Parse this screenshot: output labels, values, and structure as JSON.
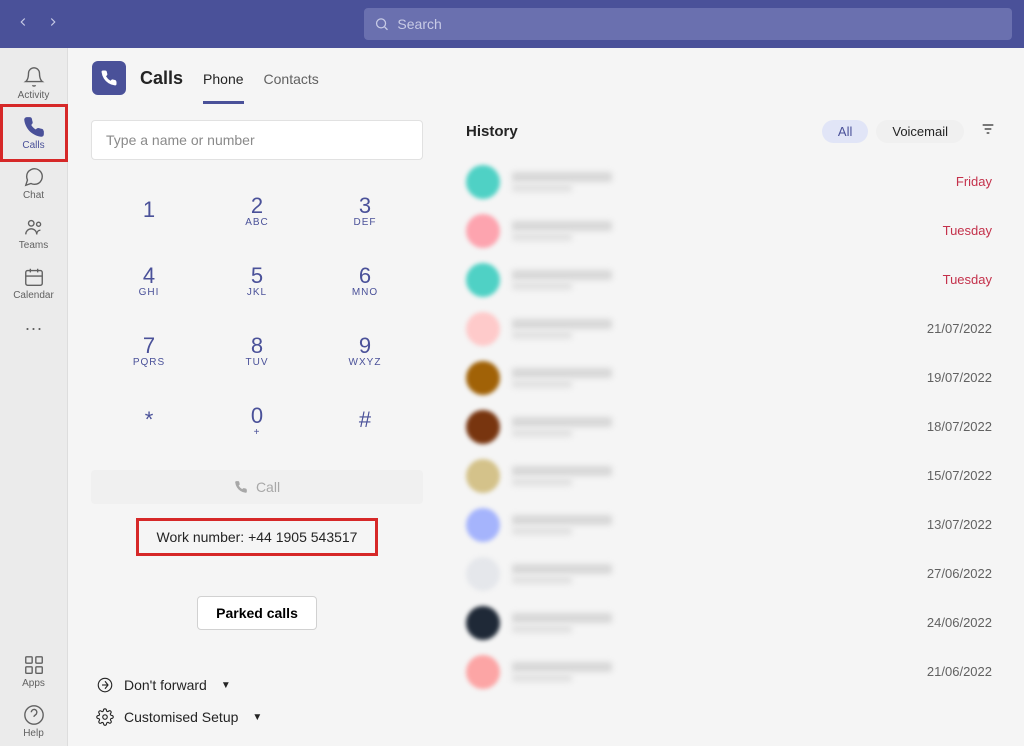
{
  "search": {
    "placeholder": "Search"
  },
  "rail": {
    "items": [
      {
        "id": "activity",
        "label": "Activity"
      },
      {
        "id": "calls",
        "label": "Calls"
      },
      {
        "id": "chat",
        "label": "Chat"
      },
      {
        "id": "teams",
        "label": "Teams"
      },
      {
        "id": "calendar",
        "label": "Calendar"
      }
    ],
    "bottom": [
      {
        "id": "apps",
        "label": "Apps"
      },
      {
        "id": "help",
        "label": "Help"
      }
    ],
    "active": "calls"
  },
  "header": {
    "title": "Calls",
    "tabs": [
      {
        "id": "phone",
        "label": "Phone",
        "active": true
      },
      {
        "id": "contacts",
        "label": "Contacts",
        "active": false
      }
    ]
  },
  "dialer": {
    "input_placeholder": "Type a name or number",
    "keys": [
      {
        "d": "1",
        "s": ""
      },
      {
        "d": "2",
        "s": "ABC"
      },
      {
        "d": "3",
        "s": "DEF"
      },
      {
        "d": "4",
        "s": "GHI"
      },
      {
        "d": "5",
        "s": "JKL"
      },
      {
        "d": "6",
        "s": "MNO"
      },
      {
        "d": "7",
        "s": "PQRS"
      },
      {
        "d": "8",
        "s": "TUV"
      },
      {
        "d": "9",
        "s": "WXYZ"
      },
      {
        "d": "*",
        "s": ""
      },
      {
        "d": "0",
        "s": "+"
      },
      {
        "d": "#",
        "s": ""
      }
    ],
    "call_label": "Call",
    "work_number_label": "Work number: +44 1905 543517",
    "parked_label": "Parked calls",
    "forward_label": "Don't forward",
    "setup_label": "Customised Setup"
  },
  "history": {
    "title": "History",
    "filters": {
      "all": "All",
      "voicemail": "Voicemail"
    },
    "rows": [
      {
        "date": "Friday",
        "missed": true,
        "avatar": "#4fd1c5"
      },
      {
        "date": "Tuesday",
        "missed": true,
        "avatar": "#fda4af"
      },
      {
        "date": "Tuesday",
        "missed": true,
        "avatar": "#4fd1c5"
      },
      {
        "date": "21/07/2022",
        "missed": false,
        "avatar": "#fecaca"
      },
      {
        "date": "19/07/2022",
        "missed": false,
        "avatar": "#a16207"
      },
      {
        "date": "18/07/2022",
        "missed": false,
        "avatar": "#78350f"
      },
      {
        "date": "15/07/2022",
        "missed": false,
        "avatar": "#d4c28a"
      },
      {
        "date": "13/07/2022",
        "missed": false,
        "avatar": "#a5b4fc"
      },
      {
        "date": "27/06/2022",
        "missed": false,
        "avatar": "#e5e7eb"
      },
      {
        "date": "24/06/2022",
        "missed": false,
        "avatar": "#1f2937"
      },
      {
        "date": "21/06/2022",
        "missed": false,
        "avatar": "#fca5a5"
      }
    ]
  }
}
